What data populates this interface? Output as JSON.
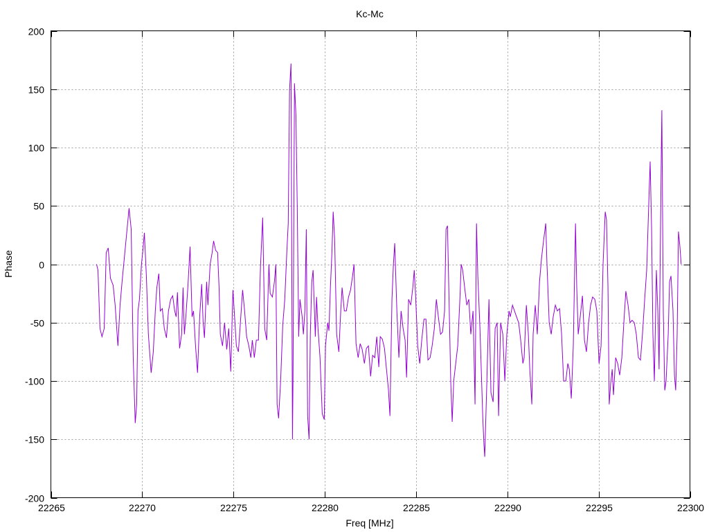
{
  "chart_data": {
    "type": "line",
    "title": "Kc-Mc",
    "xlabel": "Freq [MHz]",
    "ylabel": "Phase",
    "xlim": [
      22265,
      22300
    ],
    "ylim": [
      -200,
      200
    ],
    "xticks": [
      22265,
      22270,
      22275,
      22280,
      22285,
      22290,
      22295,
      22300
    ],
    "yticks": [
      -200,
      -150,
      -100,
      -50,
      0,
      50,
      100,
      150,
      200
    ],
    "grid": true,
    "legend": "none",
    "series": [
      {
        "name": "Kc-Mc",
        "color": "#9400d3",
        "x": [
          22267.5,
          22267.58,
          22267.69,
          22267.8,
          22267.92,
          22268.03,
          22268.14,
          22268.26,
          22268.41,
          22268.52,
          22268.67,
          22268.79,
          22268.9,
          22269.02,
          22269.17,
          22269.28,
          22269.4,
          22269.51,
          22269.62,
          22269.7,
          22269.77,
          22269.85,
          22269.96,
          22270.04,
          22270.12,
          22270.23,
          22270.34,
          22270.49,
          22270.61,
          22270.72,
          22270.8,
          22270.91,
          22270.99,
          22271.1,
          22271.21,
          22271.33,
          22271.44,
          22271.56,
          22271.67,
          22271.78,
          22271.86,
          22271.93,
          22272.05,
          22272.16,
          22272.24,
          22272.31,
          22272.39,
          22272.5,
          22272.62,
          22272.73,
          22272.81,
          22272.92,
          22273.03,
          22273.15,
          22273.26,
          22273.34,
          22273.41,
          22273.53,
          22273.6,
          22273.72,
          22273.83,
          22273.91,
          22274.02,
          22274.13,
          22274.21,
          22274.28,
          22274.4,
          22274.51,
          22274.63,
          22274.74,
          22274.85,
          22274.97,
          22275.04,
          22275.16,
          22275.27,
          22275.38,
          22275.5,
          22275.61,
          22275.72,
          22275.84,
          22275.95,
          22276.03,
          22276.14,
          22276.25,
          22276.37,
          22276.48,
          22276.6,
          22276.71,
          22276.82,
          22276.94,
          22277.01,
          22277.13,
          22277.24,
          22277.32,
          22277.39,
          22277.47,
          22277.58,
          22277.7,
          22277.81,
          22277.92,
          22278.0,
          22278.07,
          22278.15,
          22278.23,
          22278.26,
          22278.34,
          22278.42,
          22278.49,
          22278.57,
          22278.64,
          22278.76,
          22278.83,
          22278.91,
          22278.99,
          22279.06,
          22279.14,
          22279.21,
          22279.29,
          22279.36,
          22279.48,
          22279.55,
          22279.63,
          22279.74,
          22279.86,
          22279.97,
          22280.04,
          22280.16,
          22280.23,
          22280.31,
          22280.39,
          22280.46,
          22280.54,
          22280.65,
          22280.77,
          22280.88,
          22280.95,
          22281.07,
          22281.18,
          22281.3,
          22281.41,
          22281.52,
          22281.6,
          22281.71,
          22281.83,
          22281.94,
          22282.05,
          22282.17,
          22282.28,
          22282.39,
          22282.51,
          22282.62,
          22282.74,
          22282.85,
          22282.96,
          22283.04,
          22283.15,
          22283.27,
          22283.38,
          22283.49,
          22283.57,
          22283.68,
          22283.76,
          22283.83,
          22283.95,
          22284.06,
          22284.18,
          22284.29,
          22284.4,
          22284.48,
          22284.59,
          22284.71,
          22284.82,
          22284.9,
          22284.97,
          22285.09,
          22285.2,
          22285.31,
          22285.43,
          22285.54,
          22285.65,
          22285.77,
          22285.88,
          22286.0,
          22286.11,
          22286.22,
          22286.34,
          22286.45,
          22286.56,
          22286.64,
          22286.72,
          22286.79,
          22286.9,
          22286.98,
          22287.06,
          22287.17,
          22287.28,
          22287.4,
          22287.47,
          22287.55,
          22287.66,
          22287.78,
          22287.89,
          22288.0,
          22288.12,
          22288.23,
          22288.31,
          22288.38,
          22288.5,
          22288.65,
          22288.72,
          22288.76,
          22288.88,
          22288.99,
          22289.1,
          22289.22,
          22289.33,
          22289.44,
          22289.52,
          22289.63,
          22289.75,
          22289.86,
          22289.97,
          22290.09,
          22290.16,
          22290.28,
          22290.39,
          22290.5,
          22290.62,
          22290.73,
          22290.85,
          22290.92,
          22291.04,
          22291.15,
          22291.23,
          22291.34,
          22291.41,
          22291.53,
          22291.64,
          22291.76,
          22291.87,
          22291.98,
          22292.1,
          22292.17,
          22292.29,
          22292.4,
          22292.51,
          22292.63,
          22292.74,
          22292.86,
          22292.97,
          22293.08,
          22293.2,
          22293.31,
          22293.39,
          22293.5,
          22293.61,
          22293.73,
          22293.8,
          22293.88,
          22293.99,
          22294.11,
          22294.22,
          22294.33,
          22294.45,
          22294.56,
          22294.67,
          22294.79,
          22294.9,
          22295.02,
          22295.13,
          22295.24,
          22295.36,
          22295.43,
          22295.51,
          22295.58,
          22295.66,
          22295.74,
          22295.81,
          22295.93,
          22296.04,
          22296.15,
          22296.27,
          22296.38,
          22296.49,
          22296.61,
          22296.72,
          22296.83,
          22296.95,
          22297.06,
          22297.18,
          22297.29,
          22297.4,
          22297.52,
          22297.63,
          22297.74,
          22297.82,
          22297.9,
          22297.97,
          22298.05,
          22298.16,
          22298.24,
          22298.31,
          22298.43,
          22298.46,
          22298.54,
          22298.62,
          22298.69,
          22298.81,
          22298.88,
          22298.96,
          22299.07,
          22299.15,
          22299.22,
          22299.3,
          22299.37,
          22299.45,
          22299.52
        ],
        "y": [
          0,
          -5,
          -55,
          -62,
          -55,
          10,
          14,
          -12,
          -18,
          -35,
          -70,
          -35,
          -15,
          5,
          30,
          48,
          30,
          -80,
          -136,
          -120,
          -40,
          -30,
          0,
          12,
          27,
          -10,
          -60,
          -93,
          -75,
          -40,
          -20,
          -8,
          -40,
          -38,
          -55,
          -63,
          -40,
          -30,
          -27,
          -40,
          -45,
          -24,
          -72,
          -60,
          -20,
          -60,
          -45,
          -20,
          15,
          -45,
          -40,
          -70,
          -93,
          -45,
          -17,
          -50,
          -63,
          -15,
          -35,
          0,
          10,
          20,
          12,
          10,
          -20,
          -60,
          -70,
          -50,
          -73,
          -55,
          -92,
          -22,
          -40,
          -70,
          -75,
          -50,
          -22,
          -40,
          -62,
          -70,
          -80,
          -65,
          -80,
          -65,
          -65,
          -2,
          40,
          -55,
          -65,
          0,
          -25,
          -28,
          -15,
          0,
          -120,
          -132,
          -100,
          -52,
          -30,
          10,
          35,
          150,
          172,
          -150,
          -100,
          155,
          128,
          50,
          -62,
          -30,
          -45,
          -60,
          -40,
          30,
          -130,
          -150,
          -60,
          -15,
          -5,
          -62,
          -28,
          -55,
          -80,
          -128,
          -133,
          -70,
          -50,
          -57,
          -20,
          10,
          45,
          22,
          -60,
          -75,
          -38,
          -20,
          -40,
          -40,
          -28,
          -22,
          -10,
          0,
          -68,
          -80,
          -68,
          -73,
          -85,
          -72,
          -70,
          -96,
          -78,
          -80,
          -62,
          -88,
          -62,
          -64,
          -72,
          -90,
          -108,
          -130,
          -30,
          0,
          18,
          -40,
          -80,
          -40,
          -55,
          -65,
          -97,
          -30,
          -35,
          -20,
          -5,
          -25,
          -70,
          -85,
          -65,
          -47,
          -47,
          -82,
          -80,
          -70,
          -55,
          -30,
          -45,
          -60,
          -58,
          -40,
          30,
          33,
          -18,
          -100,
          -135,
          -100,
          -85,
          -70,
          -30,
          0,
          -5,
          -20,
          -35,
          -30,
          -60,
          -40,
          -120,
          35,
          -10,
          -55,
          -130,
          -155,
          -165,
          -100,
          -30,
          -110,
          -118,
          -55,
          -50,
          -130,
          -50,
          -60,
          -100,
          -60,
          -40,
          -45,
          -35,
          -40,
          -45,
          -50,
          -65,
          -85,
          -80,
          -35,
          -60,
          -90,
          -120,
          -60,
          -35,
          -60,
          -15,
          5,
          20,
          35,
          0,
          -50,
          -60,
          -45,
          -35,
          -40,
          -38,
          -60,
          -100,
          -100,
          -85,
          -90,
          -115,
          -70,
          35,
          -20,
          -60,
          -45,
          -27,
          -65,
          -75,
          -50,
          -35,
          -28,
          -30,
          -40,
          -85,
          -70,
          0,
          45,
          38,
          -20,
          -120,
          -102,
          -90,
          -112,
          -80,
          -85,
          -95,
          -80,
          -50,
          -23,
          -35,
          -50,
          -48,
          -50,
          -60,
          -80,
          -82,
          -60,
          -30,
          -5,
          50,
          88,
          30,
          -60,
          -100,
          -5,
          -40,
          -90,
          95,
          132,
          -40,
          -108,
          -100,
          -60,
          -15,
          -10,
          -40,
          -95,
          -108,
          -60,
          28,
          15,
          0
        ]
      }
    ]
  }
}
